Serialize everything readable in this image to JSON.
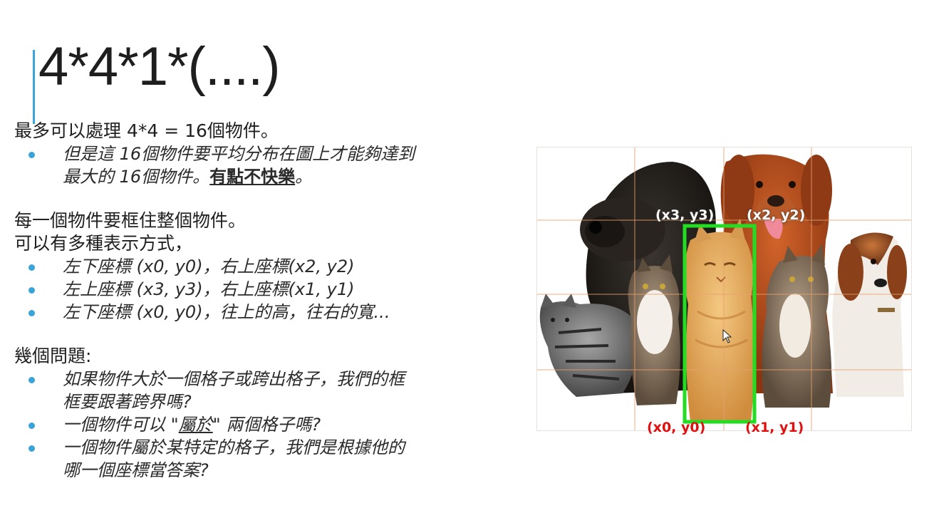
{
  "slide": {
    "title": "4*4*1*(....)",
    "para1": "最多可以處理 4*4 = 16個物件。",
    "bullet1_line1": "但是這 16個物件要平均分布在圖上才能夠達到",
    "bullet1_line2_a": "最大的 16個物件。",
    "bullet1_line2_b": "有點不快樂",
    "bullet1_line2_c": "。",
    "para2_line1": "每一個物件要框住整個物件。",
    "para2_line2": "可以有多種表示方式，",
    "rep_bullets": [
      "左下座標 (x0, y0)，右上座標(x2, y2)",
      "左上座標 (x3, y3)，右上座標(x1, y1)",
      "左下座標 (x0, y0)，往上的高，往右的寬..."
    ],
    "para3": "幾個問題:",
    "q1_line1": "如果物件大於一個格子或跨出格子，我們的框",
    "q1_line2": "框要跟著跨界嗎?",
    "q2_a": "一個物件可以 \"",
    "q2_b": "屬於",
    "q2_c": "\" 兩個格子嗎?",
    "q3_line1": "一個物件屬於某特定的格子，我們是根據他的",
    "q3_line2": "哪一個座標當答案?"
  },
  "figure": {
    "labels": {
      "x3y3": "(x3, y3)",
      "x2y2": "(x2, y2)",
      "x0y0": "(x0, y0)",
      "x1y1": "(x1, y1)"
    },
    "grid": {
      "rows": 4,
      "cols": 4
    },
    "colors": {
      "box": "#22dd22",
      "grid": "#e8a070",
      "label_top": "#ffffff",
      "label_bottom": "#e01010",
      "accent": "#3aa3d8"
    }
  }
}
